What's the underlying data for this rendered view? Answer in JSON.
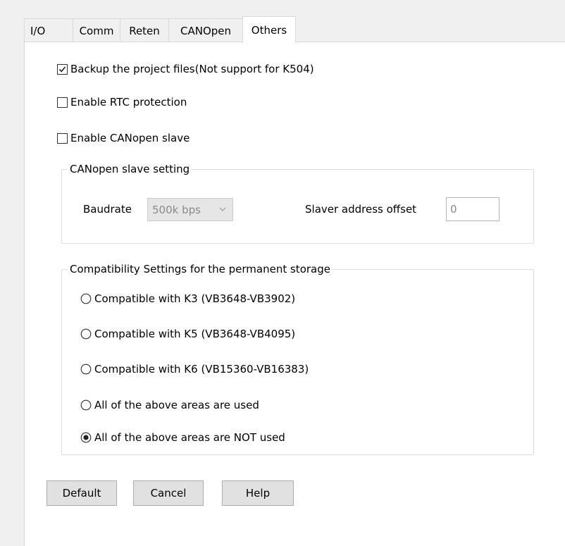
{
  "tabs": [
    {
      "label": "I/O",
      "active": false
    },
    {
      "label": "Comm",
      "active": false
    },
    {
      "label": "Reten",
      "active": false
    },
    {
      "label": "CANOpen",
      "active": false
    },
    {
      "label": "Others",
      "active": true
    }
  ],
  "options": {
    "backup": {
      "label": "Backup the project files(Not support for K504)",
      "checked": true
    },
    "rtc": {
      "label": "Enable RTC protection",
      "checked": false
    },
    "canopen_slave": {
      "label": "Enable CANopen slave",
      "checked": false
    }
  },
  "canopen_group": {
    "title": "CANopen slave setting",
    "baudrate_label": "Baudrate",
    "baudrate_value": "500k bps",
    "offset_label": "Slaver address offset",
    "offset_value": "0"
  },
  "compat_group": {
    "title": "Compatibility Settings for the permanent storage",
    "radios": [
      {
        "label": "Compatible with K3 (VB3648-VB3902)",
        "selected": false
      },
      {
        "label": "Compatible with K5 (VB3648-VB4095)",
        "selected": false
      },
      {
        "label": "Compatible with K6 (VB15360-VB16383)",
        "selected": false
      },
      {
        "label": "All of the above areas are used",
        "selected": false
      },
      {
        "label": "All of the above areas are NOT used",
        "selected": true
      }
    ]
  },
  "buttons": {
    "default": "Default",
    "cancel": "Cancel",
    "help": "Help"
  }
}
